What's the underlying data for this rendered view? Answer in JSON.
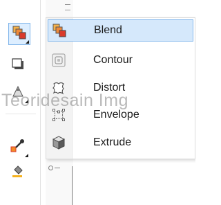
{
  "flyout": {
    "items": [
      {
        "label": "Blend",
        "icon": "blend-icon",
        "selected": true
      },
      {
        "label": "Contour",
        "icon": "contour-icon",
        "selected": false
      },
      {
        "label": "Distort",
        "icon": "distort-icon",
        "selected": false
      },
      {
        "label": "Envelope",
        "icon": "envelope-icon",
        "selected": false
      },
      {
        "label": "Extrude",
        "icon": "extrude-icon",
        "selected": false
      }
    ]
  },
  "toolbox": {
    "tools": [
      {
        "icon": "blend-tool-icon",
        "active": true
      },
      {
        "icon": "drop-shadow-tool-icon",
        "active": false
      },
      {
        "icon": "transparency-tool-icon",
        "active": false
      },
      {
        "icon": "eyedropper-tool-icon",
        "active": false
      },
      {
        "icon": "fill-tool-icon",
        "active": false
      }
    ]
  },
  "watermark": {
    "text": "Teoridesain Img"
  },
  "colors": {
    "selection_bg": "#d5e8fb",
    "selection_border": "#84b8ec",
    "accent_orange": "#f28c28",
    "accent_red": "#d93a2b"
  }
}
